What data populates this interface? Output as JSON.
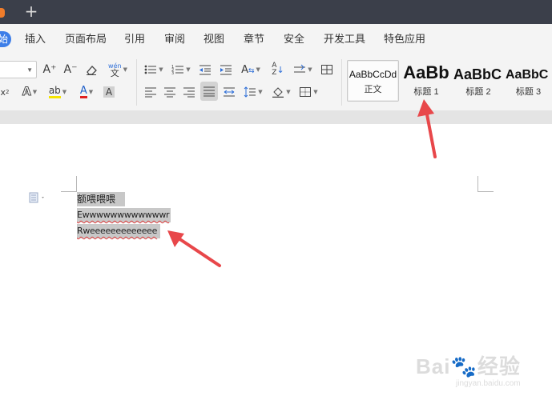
{
  "menu": {
    "start_fragment": "始",
    "items": [
      "插入",
      "页面布局",
      "引用",
      "审阅",
      "视图",
      "章节",
      "安全",
      "开发工具",
      "特色应用"
    ]
  },
  "ribbon": {
    "font_buttons": {
      "grow": "A⁺",
      "shrink": "A⁻",
      "clear": "⌫",
      "phonetic": "wén"
    },
    "styles": [
      {
        "preview": "AaBbCcDd",
        "label": "正文"
      },
      {
        "preview": "AaBb",
        "label": "标题 1"
      },
      {
        "preview": "AaBbC",
        "label": "标题 2"
      },
      {
        "preview": "AaBbC",
        "label": "标题 3"
      }
    ]
  },
  "document": {
    "lines": [
      "额喂喂喂",
      "Ewwwwwwwwwwwwr",
      "Rweeeeeeeeeeeee"
    ]
  },
  "watermark": {
    "main": "Bai🐾经验",
    "sub": "jingyan.baidu.com"
  },
  "colors": {
    "titlebar": "#3b3f4a",
    "accent": "#3d7ee8",
    "arrow": "#e8474a",
    "selection": "#c8c8c8"
  }
}
